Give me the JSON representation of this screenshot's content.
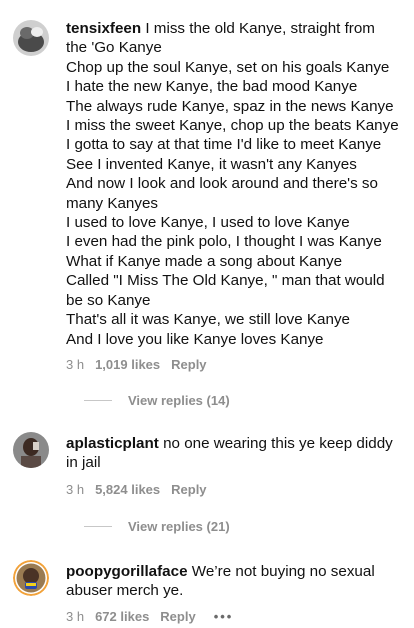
{
  "comments": [
    {
      "username": "tensixfeen",
      "lines": [
        "I miss the old Kanye, straight from",
        "the 'Go Kanye",
        "Chop up the soul Kanye, set on his goals Kanye",
        "I hate the new Kanye, the bad mood Kanye",
        "The always rude Kanye, spaz in the news Kanye",
        "I miss the sweet Kanye, chop up the beats Kanye",
        "I gotta to say at that time I'd like to meet Kanye",
        "See I invented Kanye, it wasn't any Kanyes",
        "And now I look and look around and there's so",
        "many Kanyes",
        "I used to love Kanye, I used to love Kanye",
        "I even had the pink polo, I thought I was Kanye",
        "What if Kanye made a song about Kanye",
        "Called \"I Miss The Old Kanye, \" man that would",
        "be so Kanye",
        "That's all it was Kanye, we still love Kanye",
        "And I love you like Kanye loves Kanye"
      ],
      "time": "3 h",
      "likes": "1,019 likes",
      "reply": "Reply",
      "view_replies": "View replies (14)"
    },
    {
      "username": "aplasticplant",
      "lines": [
        "no one wearing this ye keep diddy",
        "in jail"
      ],
      "time": "3 h",
      "likes": "5,824 likes",
      "reply": "Reply",
      "view_replies": "View replies (21)"
    },
    {
      "username": "poopygorillaface",
      "lines": [
        "We’re not buying no sexual",
        "abuser merch ye."
      ],
      "time": "3 h",
      "likes": "672 likes",
      "reply": "Reply",
      "more": "•••"
    }
  ]
}
